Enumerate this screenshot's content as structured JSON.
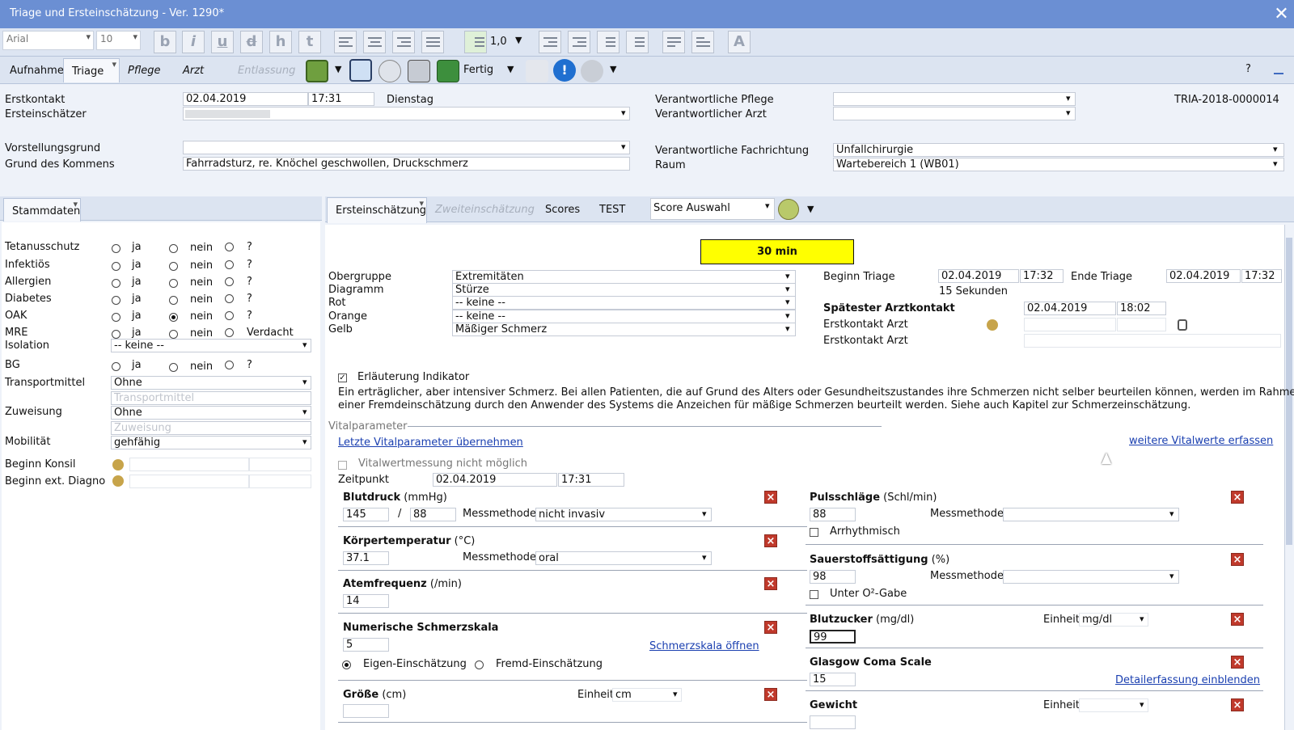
{
  "window": {
    "title": "Triage und Ersteinschätzung - Ver. 1290*",
    "close": "✕"
  },
  "toolbar": {
    "font": "Arial",
    "size": "10",
    "spacing": "1,0"
  },
  "nav": {
    "tabs": [
      "Aufnahme",
      "Triage",
      "Pflege",
      "Arzt",
      "Entlassung"
    ],
    "fertig": "Fertig",
    "help": "?"
  },
  "header": {
    "erstkontakt_label": "Erstkontakt",
    "erstkontakt_date": "02.04.2019",
    "erstkontakt_time": "17:31",
    "weekday": "Dienstag",
    "ersteinschaetzer_label": "Ersteinschätzer",
    "pflege_label": "Verantwortliche Pflege",
    "arzt_label": "Verantwortlicher Arzt",
    "case_id": "TRIA-2018-0000014",
    "vorstellungsgrund_label": "Vorstellungsgrund",
    "grund_label": "Grund des Kommens",
    "grund_value": "Fahrradsturz, re. Knöchel geschwollen, Druckschmerz",
    "fachrichtung_label": "Verantwortliche Fachrichtung",
    "fachrichtung_value": "Unfallchirurgie",
    "raum_label": "Raum",
    "raum_value": "Wartebereich 1 (WB01)"
  },
  "left": {
    "tab": "Stammdaten",
    "yes": "ja",
    "no": "nein",
    "unknown": "?",
    "verdacht": "Verdacht",
    "rows": [
      "Tetanusschutz",
      "Infektiös",
      "Allergien",
      "Diabetes",
      "OAK",
      "MRE"
    ],
    "isolation_label": "Isolation",
    "isolation_value": "-- keine --",
    "bg_label": "BG",
    "transport_label": "Transportmittel",
    "transport_value": "Ohne",
    "transport_ph": "Transportmittel",
    "zuweisung_label": "Zuweisung",
    "zuweisung_value": "Ohne",
    "zuweisung_ph": "Zuweisung",
    "mobilitaet_label": "Mobilität",
    "mobilitaet_value": "gehfähig",
    "konsil_label": "Beginn Konsil",
    "diagno_label": "Beginn ext. Diagno"
  },
  "right": {
    "tabs": [
      "Ersteinschätzung",
      "Zweiteinschätzung",
      "Scores",
      "TEST"
    ],
    "score_placeholder": "Score Auswahl",
    "urgency": "30 min",
    "urgency_color": "#ffff00",
    "obergruppe_label": "Obergruppe",
    "obergruppe": "Extremitäten",
    "diagramm_label": "Diagramm",
    "diagramm": "Stürze",
    "rot_label": "Rot",
    "rot": "-- keine --",
    "orange_label": "Orange",
    "orange": "-- keine --",
    "gelb_label": "Gelb",
    "gelb": "Mäßiger Schmerz",
    "beginn_triage_label": "Beginn Triage",
    "beginn_date": "02.04.2019",
    "beginn_time": "17:32",
    "ende_triage_label": "Ende Triage",
    "ende_date": "02.04.2019",
    "ende_time": "17:32",
    "duration": "15 Sekunden",
    "spaetester_label": "Spätester Arztkontakt",
    "spaetester_date": "02.04.2019",
    "spaetester_time": "18:02",
    "erstkontakt_arzt_label": "Erstkontakt Arzt",
    "erlaeuterung_label": "Erläuterung Indikator",
    "erlaeuterung_text1": "Ein erträglicher, aber intensiver Schmerz. Bei allen Patienten, die auf Grund des Alters oder Gesundheitszustandes ihre Schmerzen nicht selber beurteilen können, werden im Rahmen",
    "erlaeuterung_text2": "einer Fremdeinschätzung durch den Anwender des Systems die Anzeichen für mäßige Schmerzen beurteilt werden. Siehe auch Kapitel zur Schmerzeinschätzung.",
    "vitalparameter_label": "Vitalparameter",
    "letzte_link": "Letzte Vitalparameter übernehmen",
    "weitere_link": "weitere Vitalwerte erfassen",
    "nicht_moeglich": "Vitalwertmessung nicht möglich",
    "zeitpunkt_label": "Zeitpunkt",
    "zeitpunkt_date": "02.04.2019",
    "zeitpunkt_time": "17:31",
    "messmethode": "Messmethode",
    "einheit": "Einheit",
    "bp_title": "Blutdruck",
    "bp_unit": " (mmHg)",
    "bp_sys": "145",
    "bp_sep": "/",
    "bp_dia": "88",
    "bp_method": "nicht invasiv",
    "temp_title": "Körpertemperatur",
    "temp_unit": " (°C)",
    "temp_value": "37.1",
    "temp_method": "oral",
    "af_title": "Atemfrequenz",
    "af_unit": " (/min)",
    "af_value": "14",
    "ns_title": "Numerische Schmerzskala",
    "ns_value": "5",
    "ns_link": "Schmerzskala öffnen",
    "eigen": "Eigen-Einschätzung",
    "fremd": "Fremd-Einschätzung",
    "groesse_title": "Größe",
    "groesse_unit": " (cm)",
    "groesse_einheit": "cm",
    "puls_title": "Pulsschläge",
    "puls_unit": " (Schl/min)",
    "puls_value": "88",
    "arrhythmisch": "Arrhythmisch",
    "sao2_title": "Sauerstoffsättigung",
    "sao2_unit": " (%)",
    "sao2_value": "98",
    "o2_gabe": "Unter O²-Gabe",
    "bz_title": "Blutzucker",
    "bz_unit": " (mg/dl)",
    "bz_einheit": "mg/dl",
    "bz_value": "99",
    "gcs_title": "Glasgow Coma Scale",
    "gcs_value": "15",
    "gcs_link": "Detailerfassung einblenden",
    "gewicht_title": "Gewicht"
  }
}
